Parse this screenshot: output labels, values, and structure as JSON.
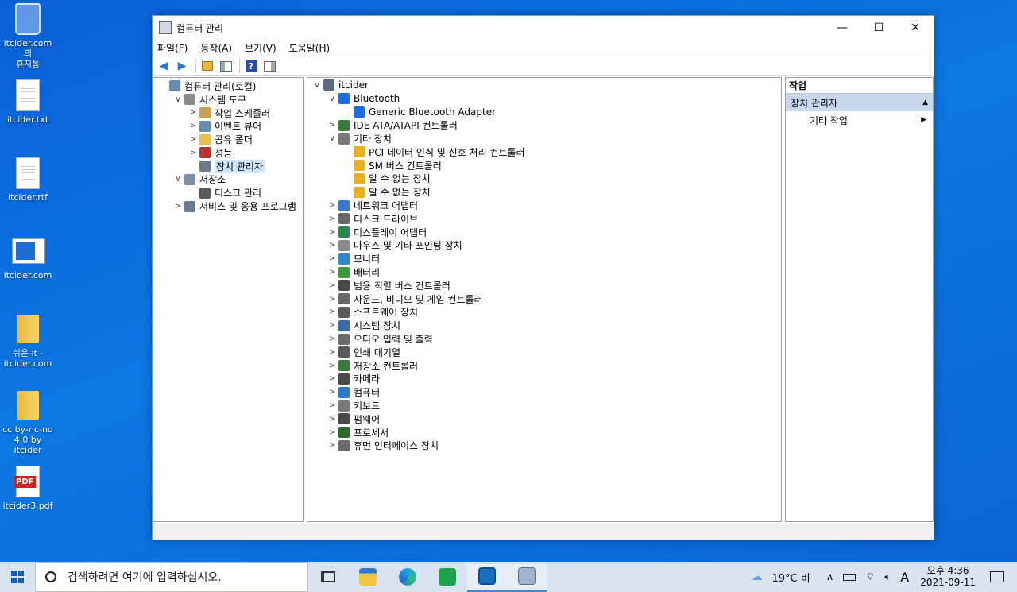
{
  "desktop": {
    "icons": [
      {
        "label": "itcider.com의\n휴지통",
        "kind": "recycle"
      },
      {
        "label": "itcider.txt",
        "kind": "doc"
      },
      {
        "label": "itcider.rtf",
        "kind": "doc"
      },
      {
        "label": "itcider.com",
        "kind": "web"
      },
      {
        "label": "쉬운 it -\nitcider.com",
        "kind": "folder"
      },
      {
        "label": "cc by-nc-nd\n4.0 by itcider",
        "kind": "folder"
      },
      {
        "label": "itcider3.pdf",
        "kind": "pdf",
        "badge": "PDF"
      }
    ]
  },
  "window": {
    "title": "컴퓨터 관리",
    "controls": {
      "minimize": "—",
      "maximize": "☐",
      "close": "✕"
    },
    "menu": [
      "파일(F)",
      "동작(A)",
      "보기(V)",
      "도움말(H)"
    ],
    "left_tree": [
      {
        "label": "컴퓨터 관리(로컬)",
        "level": 0,
        "chevron": "",
        "icon": "computer-management-icon",
        "color": "#6a8bb0"
      },
      {
        "label": "시스템 도구",
        "level": 1,
        "chevron": "∨",
        "icon": "tools-icon",
        "color": "#8a8a8a"
      },
      {
        "label": "작업 스케줄러",
        "level": 2,
        "chevron": ">",
        "icon": "clock-icon",
        "color": "#c9a04b"
      },
      {
        "label": "이벤트 뷰어",
        "level": 2,
        "chevron": ">",
        "icon": "event-viewer-icon",
        "color": "#6a8bb0"
      },
      {
        "label": "공유 폴더",
        "level": 2,
        "chevron": ">",
        "icon": "shared-folder-icon",
        "color": "#e6c04a"
      },
      {
        "label": "성능",
        "level": 2,
        "chevron": ">",
        "icon": "performance-icon",
        "color": "#c03030"
      },
      {
        "label": "장치 관리자",
        "level": 2,
        "chevron": "",
        "icon": "device-manager-icon",
        "color": "#6a7a90",
        "selected": true
      },
      {
        "label": "저장소",
        "level": 1,
        "chevron": "∨",
        "icon": "storage-icon",
        "color": "#7a8ea8"
      },
      {
        "label": "디스크 관리",
        "level": 2,
        "chevron": "",
        "icon": "disk-management-icon",
        "color": "#5a5a5a"
      },
      {
        "label": "서비스 및 응용 프로그램",
        "level": 1,
        "chevron": ">",
        "icon": "services-icon",
        "color": "#6a7a90"
      }
    ],
    "device_tree": [
      {
        "label": "itcider",
        "level": 0,
        "chevron": "∨",
        "icon": "computer-icon",
        "color": "#5a6a80"
      },
      {
        "label": "Bluetooth",
        "level": 1,
        "chevron": "∨",
        "icon": "bluetooth-icon",
        "color": "#1a6fe0"
      },
      {
        "label": "Generic Bluetooth Adapter",
        "level": 2,
        "chevron": "",
        "icon": "bluetooth-warning-icon",
        "color": "#1a6fe0"
      },
      {
        "label": "IDE ATA/ATAPI 컨트롤러",
        "level": 1,
        "chevron": ">",
        "icon": "ide-controller-icon",
        "color": "#3a7a3a"
      },
      {
        "label": "기타 장치",
        "level": 1,
        "chevron": "∨",
        "icon": "other-devices-icon",
        "color": "#7a7a7a"
      },
      {
        "label": "PCI 데이터 인식 및 신호 처리 컨트롤러",
        "level": 2,
        "chevron": "",
        "icon": "warning-device-icon",
        "color": "#e8b020"
      },
      {
        "label": "SM 버스 컨트롤러",
        "level": 2,
        "chevron": "",
        "icon": "warning-device-icon",
        "color": "#e8b020"
      },
      {
        "label": "알 수 없는 장치",
        "level": 2,
        "chevron": "",
        "icon": "warning-device-icon",
        "color": "#e8b020"
      },
      {
        "label": "알 수 없는 장치",
        "level": 2,
        "chevron": "",
        "icon": "warning-device-icon",
        "color": "#e8b020"
      },
      {
        "label": "네트워크 어댑터",
        "level": 1,
        "chevron": ">",
        "icon": "network-adapter-icon",
        "color": "#3a7ac8"
      },
      {
        "label": "디스크 드라이브",
        "level": 1,
        "chevron": ">",
        "icon": "disk-drive-icon",
        "color": "#6a6a6a"
      },
      {
        "label": "디스플레이 어댑터",
        "level": 1,
        "chevron": ">",
        "icon": "display-adapter-icon",
        "color": "#2a8a4a"
      },
      {
        "label": "마우스 및 기타 포인팅 장치",
        "level": 1,
        "chevron": ">",
        "icon": "mouse-icon",
        "color": "#8a8a8a"
      },
      {
        "label": "모니터",
        "level": 1,
        "chevron": ">",
        "icon": "monitor-icon",
        "color": "#2a8ad0"
      },
      {
        "label": "배터리",
        "level": 1,
        "chevron": ">",
        "icon": "battery-icon",
        "color": "#3a9a3a"
      },
      {
        "label": "범용 직렬 버스 컨트롤러",
        "level": 1,
        "chevron": ">",
        "icon": "usb-icon",
        "color": "#4a4a4a"
      },
      {
        "label": "사운드, 비디오 및 게임 컨트롤러",
        "level": 1,
        "chevron": ">",
        "icon": "sound-icon",
        "color": "#6a6a6a"
      },
      {
        "label": "소프트웨어 장치",
        "level": 1,
        "chevron": ">",
        "icon": "software-device-icon",
        "color": "#5a5a5a"
      },
      {
        "label": "시스템 장치",
        "level": 1,
        "chevron": ">",
        "icon": "system-device-icon",
        "color": "#3a6aa8"
      },
      {
        "label": "오디오 입력 및 출력",
        "level": 1,
        "chevron": ">",
        "icon": "audio-icon",
        "color": "#6a6a6a"
      },
      {
        "label": "인쇄 대기열",
        "level": 1,
        "chevron": ">",
        "icon": "printer-icon",
        "color": "#5a5a5a"
      },
      {
        "label": "저장소 컨트롤러",
        "level": 1,
        "chevron": ">",
        "icon": "storage-controller-icon",
        "color": "#3a7a3a"
      },
      {
        "label": "카메라",
        "level": 1,
        "chevron": ">",
        "icon": "camera-icon",
        "color": "#4a4a4a"
      },
      {
        "label": "컴퓨터",
        "level": 1,
        "chevron": ">",
        "icon": "computer-icon",
        "color": "#2a7ac8"
      },
      {
        "label": "키보드",
        "level": 1,
        "chevron": ">",
        "icon": "keyboard-icon",
        "color": "#7a7a7a"
      },
      {
        "label": "펌웨어",
        "level": 1,
        "chevron": ">",
        "icon": "firmware-icon",
        "color": "#4a4a4a"
      },
      {
        "label": "프로세서",
        "level": 1,
        "chevron": ">",
        "icon": "processor-icon",
        "color": "#2a6a2a"
      },
      {
        "label": "휴먼 인터페이스 장치",
        "level": 1,
        "chevron": ">",
        "icon": "hid-icon",
        "color": "#6a6a6a"
      }
    ],
    "actions": {
      "header": "작업",
      "section": "장치 관리자",
      "items": [
        "기타 작업"
      ]
    }
  },
  "taskbar": {
    "search_placeholder": "검색하려면 여기에 입력하십시오.",
    "weather": "19°C 비",
    "ime": "A",
    "time": "오후 4:36",
    "date": "2021-09-11"
  }
}
